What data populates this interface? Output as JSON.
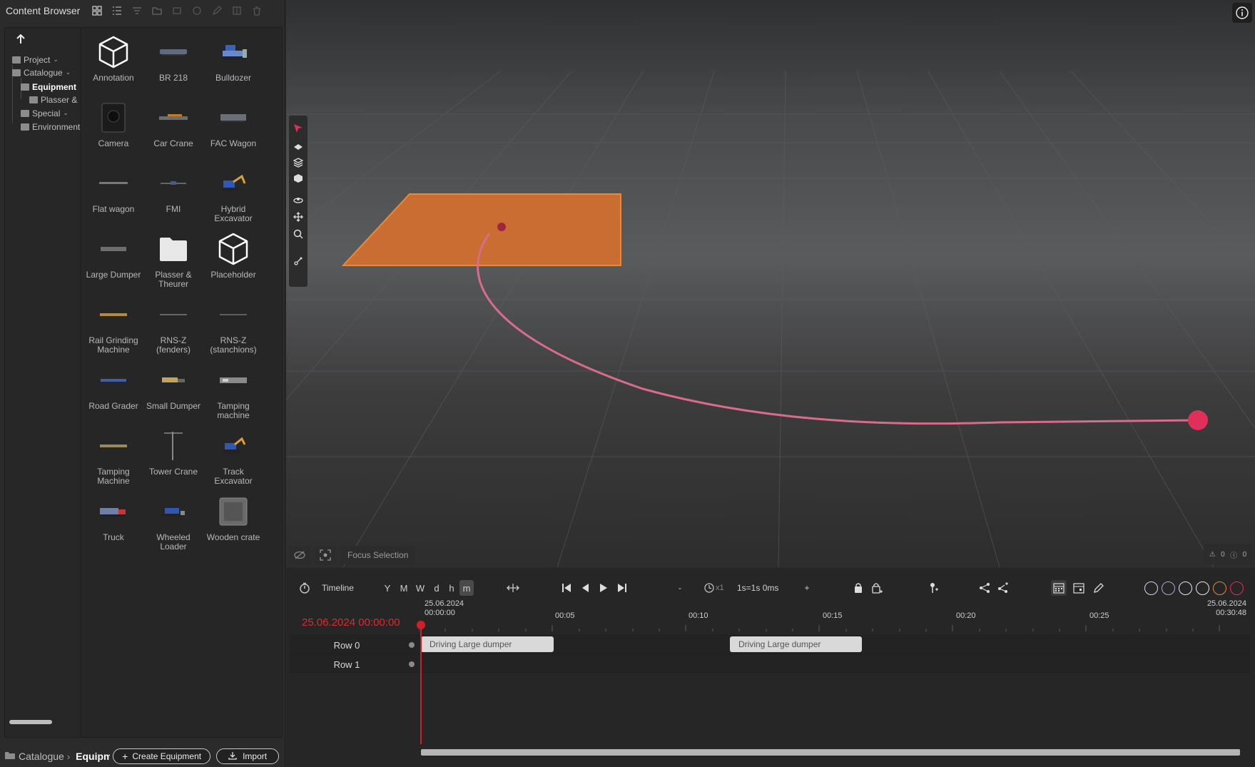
{
  "content_browser": {
    "title": "Content Browser",
    "tree": [
      {
        "label": "Project"
      },
      {
        "label": "Catalogue"
      },
      {
        "label": "Equipment"
      },
      {
        "label": "Plasser &"
      },
      {
        "label": "Special"
      },
      {
        "label": "Environment"
      }
    ],
    "items": [
      {
        "label": "Annotation",
        "icon": "cube-icon"
      },
      {
        "label": "BR 218",
        "icon": "locomotive-icon"
      },
      {
        "label": "Bulldozer",
        "icon": "bulldozer-icon"
      },
      {
        "label": "Camera",
        "icon": "camera-icon"
      },
      {
        "label": "Car Crane",
        "icon": "car-crane-icon"
      },
      {
        "label": "FAC Wagon",
        "icon": "wagon-icon"
      },
      {
        "label": "Flat wagon",
        "icon": "flat-wagon-icon"
      },
      {
        "label": "FMI",
        "icon": "fmi-icon"
      },
      {
        "label": "Hybrid Excavator",
        "icon": "excavator-icon"
      },
      {
        "label": "Large Dumper",
        "icon": "dumper-icon"
      },
      {
        "label": "Plasser & Theurer",
        "icon": "folder-icon"
      },
      {
        "label": "Placeholder",
        "icon": "cube-icon"
      },
      {
        "label": "Rail Grinding Machine",
        "icon": "rail-grinder-icon"
      },
      {
        "label": "RNS-Z (fenders)",
        "icon": "rns-fenders-icon"
      },
      {
        "label": "RNS-Z (stanchions)",
        "icon": "rns-stanchions-icon"
      },
      {
        "label": "Road Grader",
        "icon": "road-grader-icon"
      },
      {
        "label": "Small Dumper",
        "icon": "small-dumper-icon"
      },
      {
        "label": "Tamping machine",
        "icon": "tamping-machine-icon"
      },
      {
        "label": "Tamping Machine",
        "icon": "tamping-machine-icon"
      },
      {
        "label": "Tower Crane",
        "icon": "tower-crane-icon"
      },
      {
        "label": "Track Excavator",
        "icon": "track-excavator-icon"
      },
      {
        "label": "Truck",
        "icon": "truck-icon"
      },
      {
        "label": "Wheeled Loader",
        "icon": "wheeled-loader-icon"
      },
      {
        "label": "Wooden crate",
        "icon": "crate-icon"
      }
    ],
    "breadcrumb": {
      "parent": "Catalogue",
      "current": "Equipment"
    },
    "create_label": "Create Equipment",
    "import_label": "Import"
  },
  "viewport": {
    "focus_label": "Focus Selection",
    "warning_count": "0",
    "error_count": "0",
    "object_color": "#d2712f",
    "path_color": "#e0305a"
  },
  "timeline": {
    "label": "Timeline",
    "zoom_levels": [
      "Y",
      "M",
      "W",
      "d",
      "h",
      "m"
    ],
    "active_zoom": "m",
    "speed_minus": "-",
    "speed_multiplier": "x1",
    "speed_value": "1s=1s 0ms",
    "speed_plus": "+",
    "current_datetime": "25.06.2024 00:00:00",
    "start_date": "25.06.2024",
    "start_time": "00:00:00",
    "end_date": "25.06.2024",
    "end_time": "00:30:48",
    "ticks": [
      "00:05",
      "00:10",
      "00:15",
      "00:20",
      "00:25"
    ],
    "rows": [
      {
        "label": "Row 0",
        "clips": [
          "Driving Large dumper",
          "Driving Large dumper"
        ]
      },
      {
        "label": "Row 1",
        "clips": []
      }
    ],
    "accent_color": "#d21f27"
  }
}
